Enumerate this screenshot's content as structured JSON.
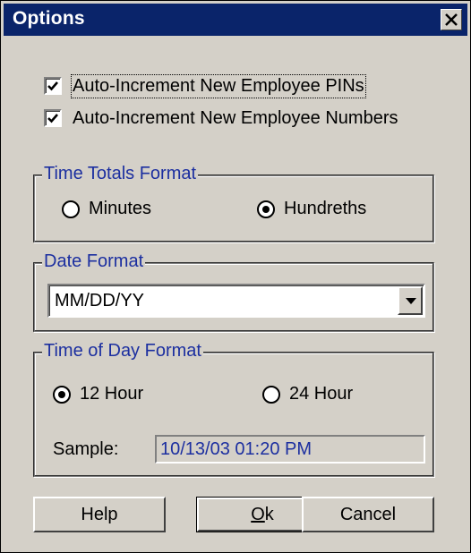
{
  "window": {
    "title": "Options"
  },
  "checkboxes": [
    {
      "label": "Auto-Increment New Employee PINs",
      "checked": true,
      "focused": true
    },
    {
      "label": "Auto-Increment New Employee Numbers",
      "checked": true
    }
  ],
  "time_totals": {
    "legend": "Time Totals Format",
    "options": [
      {
        "label": "Minutes",
        "selected": false
      },
      {
        "label": "Hundreths",
        "selected": true
      }
    ]
  },
  "date_format": {
    "legend": "Date Format",
    "value": "MM/DD/YY"
  },
  "time_of_day": {
    "legend": "Time of Day Format",
    "options": [
      {
        "label": "12 Hour",
        "selected": true
      },
      {
        "label": "24 Hour",
        "selected": false
      }
    ],
    "sample_label": "Sample:",
    "sample_value": "10/13/03 01:20 PM"
  },
  "buttons": {
    "help": "Help",
    "ok_mnemonic": "O",
    "ok_rest": "k",
    "cancel": "Cancel"
  },
  "colors": {
    "titlebar": "#0a246a",
    "face": "#d4d0c8",
    "legend_text": "#1c2fa0"
  }
}
